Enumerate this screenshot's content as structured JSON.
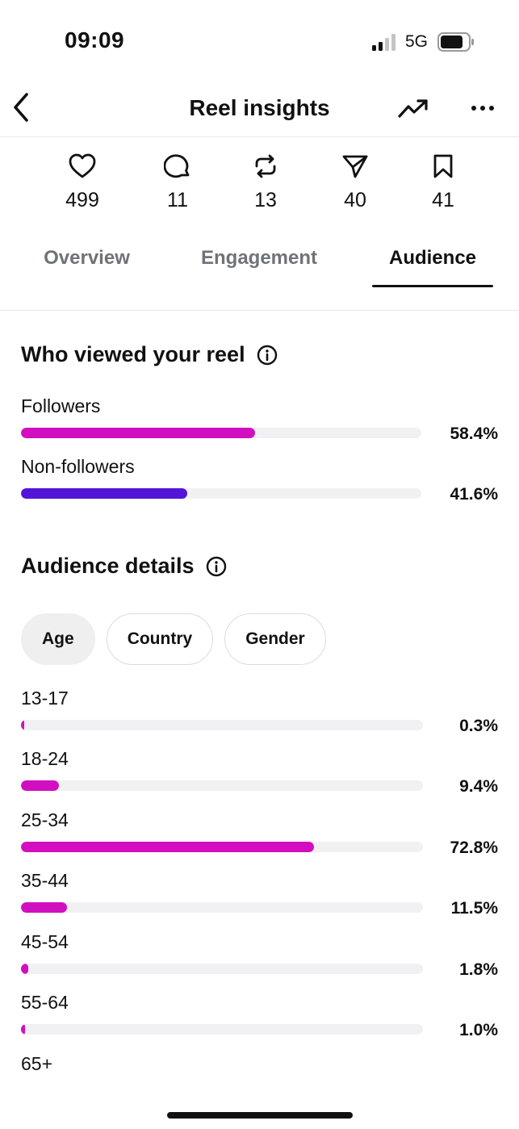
{
  "status_bar": {
    "time": "09:09",
    "network": "5G"
  },
  "header": {
    "title": "Reel insights",
    "back_icon": "chevron-left-icon",
    "trend_icon": "trending-up-icon",
    "more_icon": "more-horizontal-icon"
  },
  "metrics": [
    {
      "icon": "heart-icon",
      "value": "499"
    },
    {
      "icon": "comment-icon",
      "value": "11"
    },
    {
      "icon": "repost-icon",
      "value": "13"
    },
    {
      "icon": "share-icon",
      "value": "40"
    },
    {
      "icon": "bookmark-icon",
      "value": "41"
    }
  ],
  "tabs": [
    {
      "label": "Overview",
      "active": false
    },
    {
      "label": "Engagement",
      "active": false
    },
    {
      "label": "Audience",
      "active": true
    }
  ],
  "viewers": {
    "title": "Who viewed your reel",
    "rows": [
      {
        "label": "Followers",
        "value": "58.4%",
        "fraction": 0.584,
        "color": "#d20fc0"
      },
      {
        "label": "Non-followers",
        "value": "41.6%",
        "fraction": 0.416,
        "color": "#5314d9"
      }
    ]
  },
  "audience": {
    "title": "Audience details",
    "chips": [
      {
        "label": "Age",
        "active": true
      },
      {
        "label": "Country",
        "active": false
      },
      {
        "label": "Gender",
        "active": false
      }
    ],
    "rows": [
      {
        "label": "13-17",
        "value": "0.3%",
        "fraction": 0.003
      },
      {
        "label": "18-24",
        "value": "9.4%",
        "fraction": 0.094
      },
      {
        "label": "25-34",
        "value": "72.8%",
        "fraction": 0.728
      },
      {
        "label": "35-44",
        "value": "11.5%",
        "fraction": 0.115
      },
      {
        "label": "45-54",
        "value": "1.8%",
        "fraction": 0.018
      },
      {
        "label": "55-64",
        "value": "1.0%",
        "fraction": 0.01
      }
    ],
    "partial_label": "65+",
    "bar_color": "#d20fc0"
  }
}
